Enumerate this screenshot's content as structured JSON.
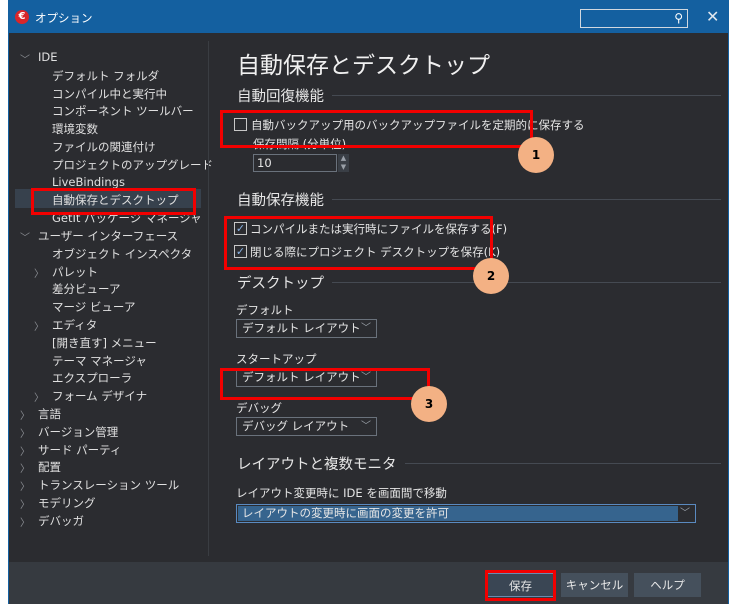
{
  "window": {
    "title": "オプション",
    "search_placeholder": "",
    "icons": {
      "logo": "app-logo-icon",
      "search": "search-icon",
      "close": "close-icon"
    }
  },
  "tree": [
    {
      "label": "IDE",
      "level": 0,
      "expander": "expanded"
    },
    {
      "label": "デフォルト フォルダ",
      "level": 1
    },
    {
      "label": "コンパイル中と実行中",
      "level": 1
    },
    {
      "label": "コンポーネント ツールバー",
      "level": 1
    },
    {
      "label": "環境変数",
      "level": 1
    },
    {
      "label": "ファイルの関連付け",
      "level": 1
    },
    {
      "label": "プロジェクトのアップグレード",
      "level": 1
    },
    {
      "label": "LiveBindings",
      "level": 1
    },
    {
      "label": "自動保存とデスクトップ",
      "level": 1,
      "selected": true
    },
    {
      "label": "GetIt パッケージ マネージャ",
      "level": 1
    },
    {
      "label": "ユーザー インターフェース",
      "level": 0,
      "expander": "expanded"
    },
    {
      "label": "オブジェクト インスペクタ",
      "level": 1
    },
    {
      "label": "パレット",
      "level": 1,
      "expander": "collapsed"
    },
    {
      "label": "差分ビューア",
      "level": 1
    },
    {
      "label": "マージ ビューア",
      "level": 1
    },
    {
      "label": "エディタ",
      "level": 1,
      "expander": "collapsed"
    },
    {
      "label": "[開き直す] メニュー",
      "level": 1
    },
    {
      "label": "テーマ マネージャ",
      "level": 1
    },
    {
      "label": "エクスプローラ",
      "level": 1
    },
    {
      "label": "フォーム デザイナ",
      "level": 1,
      "expander": "collapsed"
    },
    {
      "label": "言語",
      "level": 0,
      "expander": "collapsed"
    },
    {
      "label": "バージョン管理",
      "level": 0,
      "expander": "collapsed"
    },
    {
      "label": "サード パーティ",
      "level": 0,
      "expander": "collapsed"
    },
    {
      "label": "配置",
      "level": 0,
      "expander": "collapsed"
    },
    {
      "label": "トランスレーション ツール",
      "level": 0,
      "expander": "collapsed"
    },
    {
      "label": "モデリング",
      "level": 0,
      "expander": "collapsed"
    },
    {
      "label": "デバッガ",
      "level": 0,
      "expander": "collapsed"
    }
  ],
  "main": {
    "title": "自動保存とデスクトップ",
    "recovery": {
      "heading": "自動回復機能",
      "backup_label": "自動バックアップ用のバックアップファイルを定期的に保存する",
      "backup_checked": false,
      "interval_label": "保存間隔 (分単位)",
      "interval_value": "10"
    },
    "autosave": {
      "heading": "自動保存機能",
      "save_files_label": "コンパイルまたは実行時にファイルを保存する(F)",
      "save_files_checked": true,
      "save_desktop_label": "閉じる際にプロジェクト デスクトップを保存(K)",
      "save_desktop_checked": true
    },
    "desktop": {
      "heading": "デスクトップ",
      "default_label": "デフォルト",
      "default_value": "デフォルト レイアウト",
      "startup_label": "スタートアップ",
      "startup_value": "デフォルト レイアウト",
      "debug_label": "デバッグ",
      "debug_value": "デバッグ レイアウト"
    },
    "layout": {
      "heading": "レイアウトと複数モニタ",
      "move_label": "レイアウト変更時に IDE を画面間で移動",
      "move_value": "レイアウトの変更時に画面の変更を許可"
    }
  },
  "annotations": {
    "badges": [
      "1",
      "2",
      "3"
    ],
    "highlight_color": "#f20000",
    "badge_color": "#f3b184"
  },
  "footer": {
    "save": "保存",
    "cancel": "キャンセル",
    "help": "ヘルプ"
  }
}
